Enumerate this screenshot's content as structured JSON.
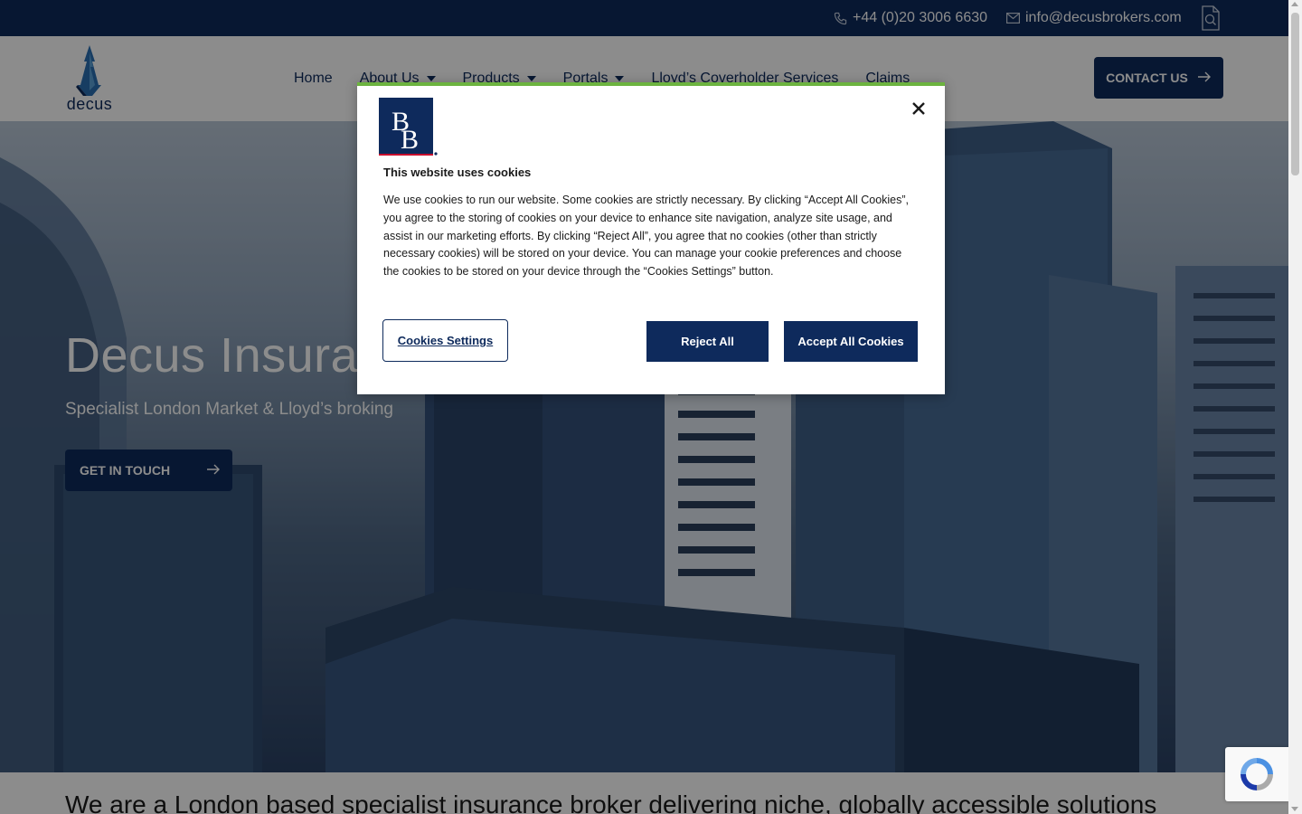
{
  "topbar": {
    "phone": "+44 (0)20 3006 6630",
    "email": "info@decusbrokers.com",
    "search_icon": "document-search-icon"
  },
  "header": {
    "logo_text": "decus",
    "nav": [
      {
        "label": "Home",
        "dropdown": false
      },
      {
        "label": "About Us",
        "dropdown": true
      },
      {
        "label": "Products",
        "dropdown": true
      },
      {
        "label": "Portals",
        "dropdown": true
      },
      {
        "label": "Lloyd’s Coverholder Services",
        "dropdown": false
      },
      {
        "label": "Claims",
        "dropdown": false
      }
    ],
    "contact_button": "CONTACT US"
  },
  "hero": {
    "title": "Decus Insura",
    "subtitle": "Specialist London Market & Lloyd’s broking",
    "button": "GET IN TOUCH"
  },
  "intro_text": "We are a London based specialist insurance broker delivering niche, globally accessible solutions",
  "cookie_modal": {
    "logo_text": "BB",
    "title": "This website uses cookies",
    "body": "We use cookies to run our website. Some cookies are strictly necessary. By clicking “Accept All Cookies”, you agree to the storing of cookies on your device to enhance site navigation, analyze site usage, and assist in our marketing efforts. By clicking “Reject All”, you agree that no cookies (other than strictly necessary cookies) will be stored on your device. You can manage your cookie preferences and choose the cookies to be stored on your device through the “Cookies Settings” button.",
    "settings_button": "Cookies Settings",
    "reject_button": "Reject All",
    "accept_button": "Accept All Cookies"
  },
  "colors": {
    "brand_navy": "#0e2a5c",
    "modal_accent": "#6cb33f"
  }
}
